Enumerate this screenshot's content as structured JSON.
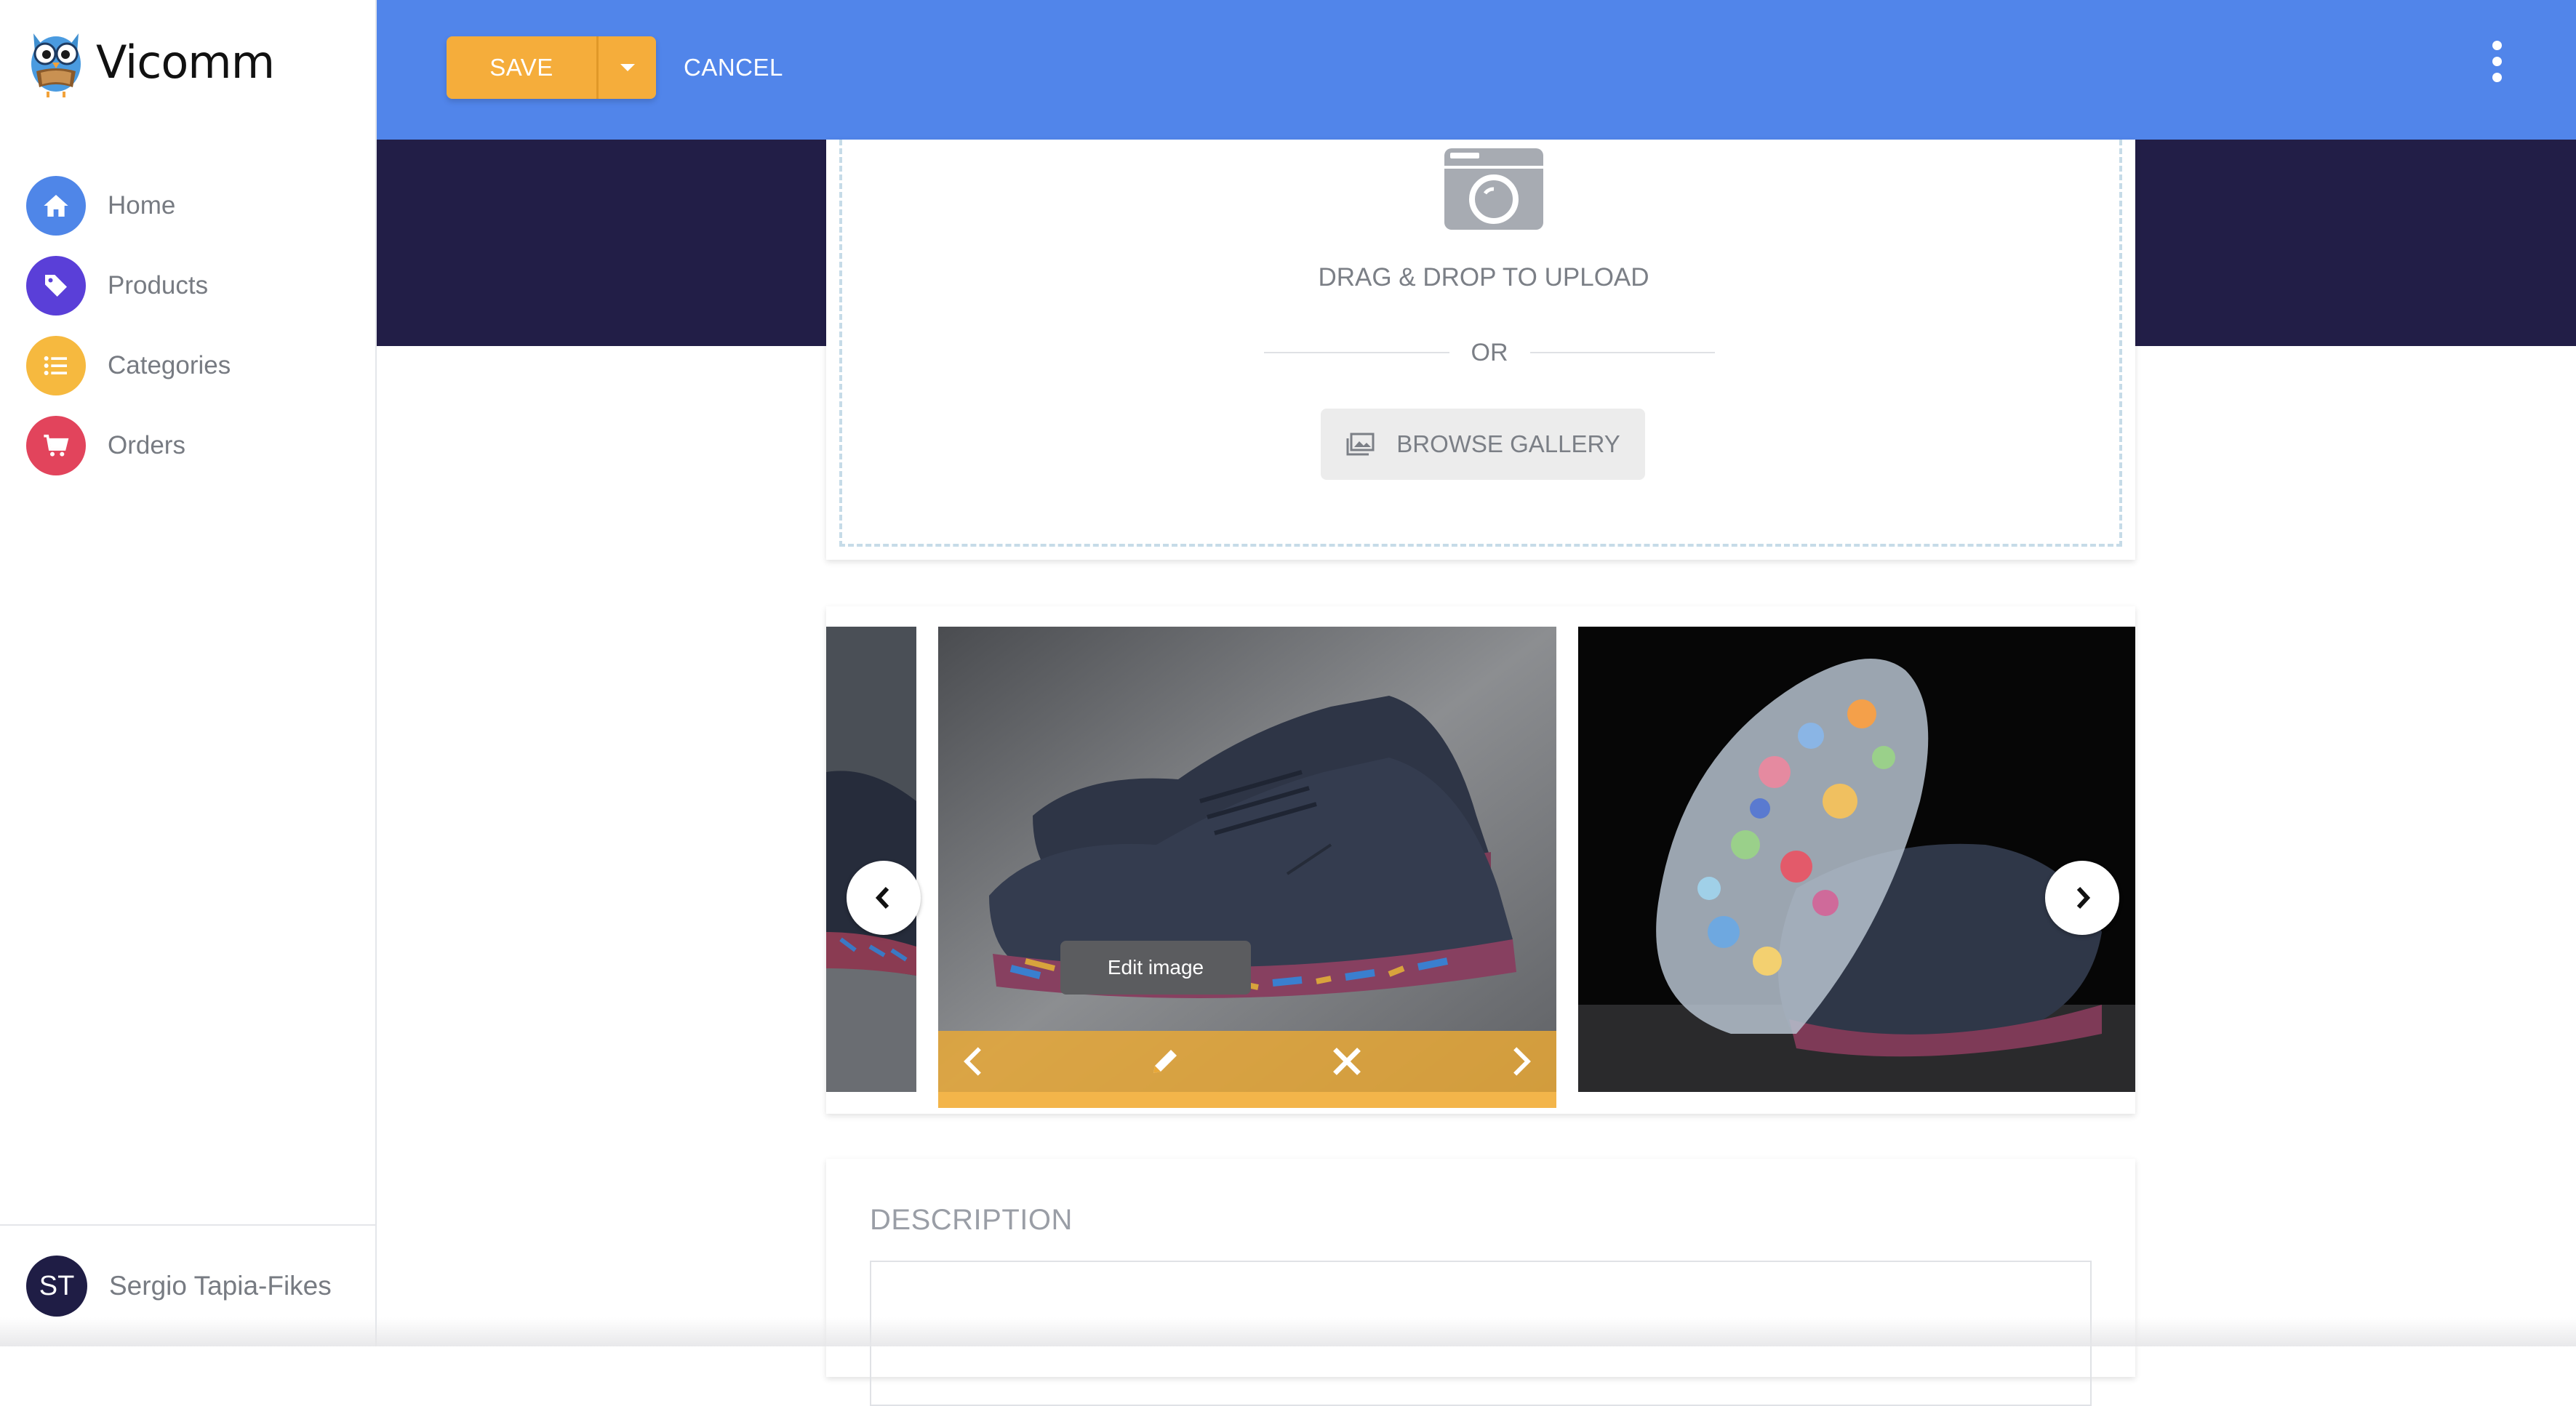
{
  "app": {
    "name": "Vicomm",
    "logo_icon": "owl-logo-icon"
  },
  "sidebar": {
    "items": [
      {
        "label": "Home",
        "icon": "home-icon",
        "color": "#4f86e8"
      },
      {
        "label": "Products",
        "icon": "tag-icon",
        "color": "#5a3fd8"
      },
      {
        "label": "Categories",
        "icon": "list-icon",
        "color": "#f6b93f"
      },
      {
        "label": "Orders",
        "icon": "cart-icon",
        "color": "#e2445c"
      }
    ],
    "user": {
      "initials": "ST",
      "name": "Sergio Tapia-Fikes"
    }
  },
  "toolbar": {
    "save_label": "SAVE",
    "cancel_label": "CANCEL",
    "accent_color": "#f5ad3b",
    "header_color": "#5185ea"
  },
  "upload": {
    "drag_text": "DRAG & DROP TO UPLOAD",
    "or_text": "OR",
    "browse_label": "BROWSE GALLERY"
  },
  "gallery": {
    "tooltip": "Edit image"
  },
  "description": {
    "label": "DESCRIPTION",
    "value": ""
  }
}
